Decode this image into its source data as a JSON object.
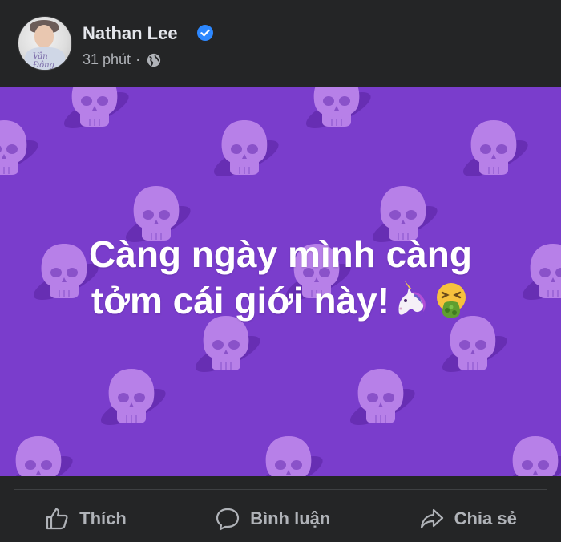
{
  "post": {
    "author": "Nathan Lee",
    "time": "31 phút",
    "separator": "·",
    "text_line1": "Càng ngày mình càng",
    "text_line2": "tởm cái giới này!",
    "emojis": [
      "unicorn-icon",
      "vomiting-face-icon"
    ],
    "background_color": "#7a3dcc"
  },
  "actions": {
    "like_label": "Thích",
    "comment_label": "Bình luận",
    "share_label": "Chia sẻ"
  },
  "colors": {
    "verified": "#2d88ff",
    "text_secondary": "#b0b3b8"
  }
}
